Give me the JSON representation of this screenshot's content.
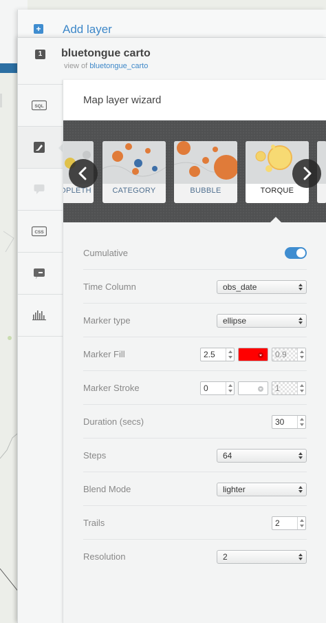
{
  "add_layer": {
    "icon": "plus-icon",
    "label": "Add layer"
  },
  "layer": {
    "number": "1",
    "title": "bluetongue carto",
    "view_of_prefix": "view of",
    "view_of_link": "bluetongue_carto"
  },
  "tools": [
    {
      "icon": "sql-icon",
      "label": "SQL"
    },
    {
      "icon": "wizard-brush-icon",
      "label": ""
    },
    {
      "icon": "infowindow-icon",
      "label": ""
    },
    {
      "icon": "css-icon",
      "label": "CSS"
    },
    {
      "icon": "legend-icon",
      "label": ""
    },
    {
      "icon": "filters-icon",
      "label": ""
    }
  ],
  "wizard": {
    "title": "Map layer wizard",
    "types": [
      {
        "label": "OPLETH",
        "selected": false
      },
      {
        "label": "CATEGORY",
        "selected": false
      },
      {
        "label": "BUBBLE",
        "selected": false
      },
      {
        "label": "TORQUE",
        "selected": true
      }
    ],
    "nav_prev_icon": "chevron-left-icon",
    "nav_next_icon": "chevron-right-icon"
  },
  "form": {
    "cumulative": {
      "label": "Cumulative",
      "enabled": true
    },
    "time_column": {
      "label": "Time Column",
      "value": "obs_date"
    },
    "marker_type": {
      "label": "Marker type",
      "value": "ellipse"
    },
    "marker_fill": {
      "label": "Marker Fill",
      "width": "2.5",
      "color": "#ff0000",
      "opacity": "0.9"
    },
    "marker_stroke": {
      "label": "Marker Stroke",
      "width": "0",
      "color": "#ffffff",
      "opacity": "1"
    },
    "duration": {
      "label": "Duration (secs)",
      "value": "30"
    },
    "steps": {
      "label": "Steps",
      "value": "64"
    },
    "blend_mode": {
      "label": "Blend Mode",
      "value": "lighter"
    },
    "trails": {
      "label": "Trails",
      "value": "2"
    },
    "resolution": {
      "label": "Resolution",
      "value": "2"
    }
  },
  "colors": {
    "accent": "#3d87c8",
    "toggle_on": "#3f8dd0",
    "carousel_bg": "#505152",
    "bubble_orange": "#e07b39"
  }
}
